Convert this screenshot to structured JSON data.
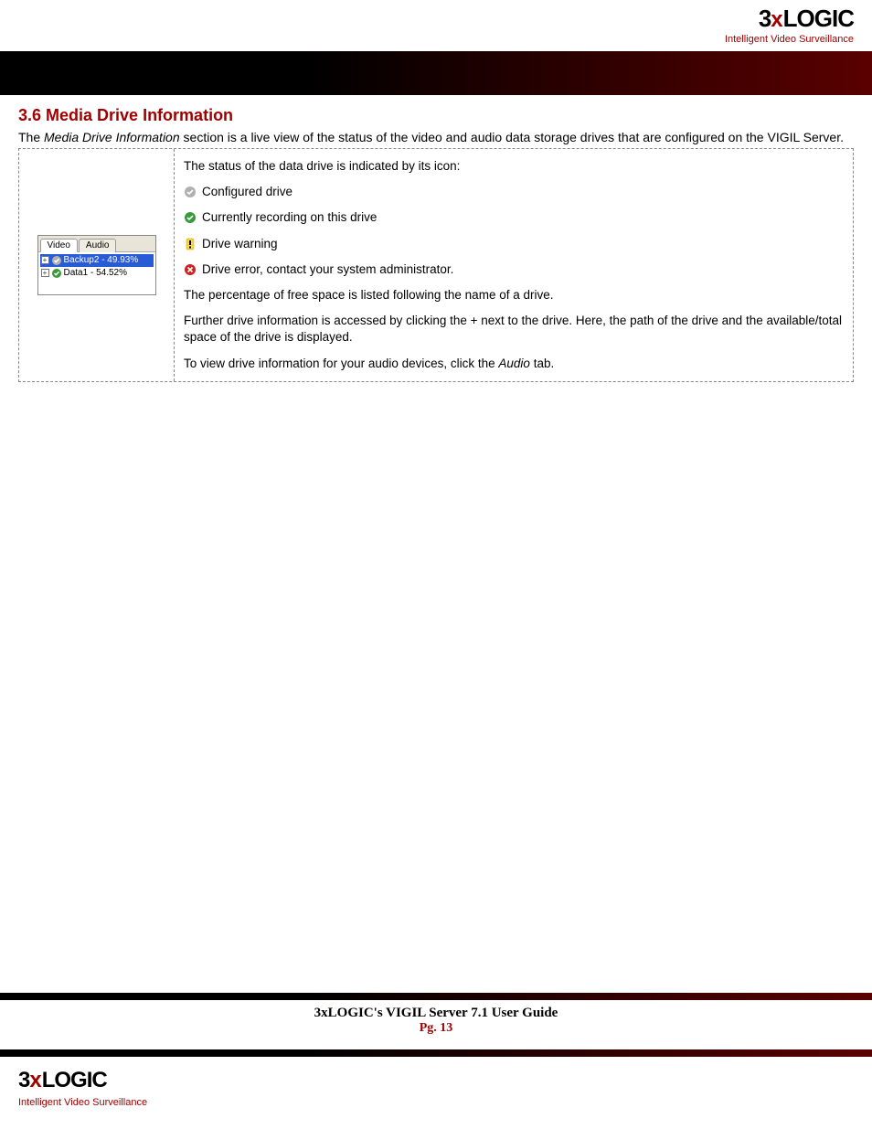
{
  "brand": {
    "logo_prefix": "3",
    "logo_x": "x",
    "logo_suffix": "LOGIC",
    "tagline": "Intelligent Video Surveillance"
  },
  "section": {
    "heading": "3.6 Media Drive Information",
    "intro_lead": "The ",
    "intro_ital": "Media Drive Information",
    "intro_rest": " section is a live view of the status of the video and audio data storage drives that are configured on the VIGIL Server."
  },
  "mini": {
    "tab_video": "Video",
    "tab_audio": "Audio",
    "rows": [
      {
        "label": "Backup2 - 49.93%",
        "selected": true,
        "icon": "configured"
      },
      {
        "label": "Data1 - 54.52%",
        "selected": false,
        "icon": "recording"
      }
    ]
  },
  "body": {
    "status_intro": "The status of the data drive is indicated by its icon:",
    "legend": {
      "configured": "Configured drive",
      "recording": "Currently recording on this drive",
      "warning": "Drive warning",
      "error": "Drive error, contact your system administrator."
    },
    "p_percent": "The percentage of free space is listed following the name of a drive.",
    "p_further": "Further drive information is accessed by clicking the + next to the drive. Here, the path of the drive and the available/total space of the drive is displayed.",
    "p_audio_pre": "To view drive information for your audio devices, click the ",
    "p_audio_ital": "Audio",
    "p_audio_post": " tab."
  },
  "footer": {
    "guide": "3xLOGIC's VIGIL Server 7.1 User Guide",
    "page": "Pg. 13"
  }
}
